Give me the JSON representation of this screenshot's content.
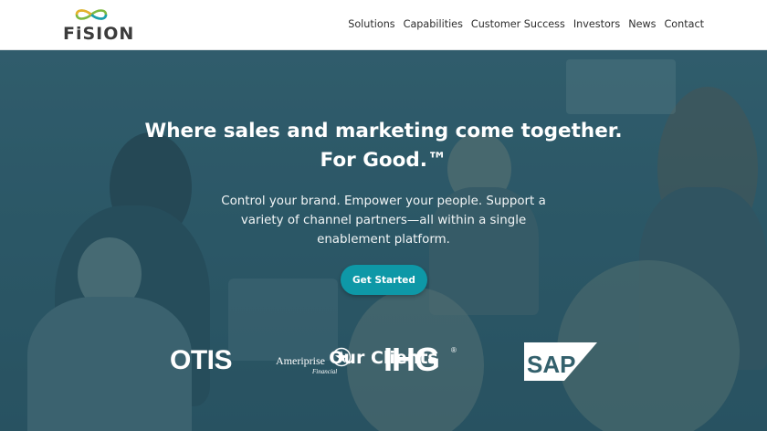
{
  "header": {
    "logo_text": "FiSION",
    "nav": [
      {
        "label": "Solutions"
      },
      {
        "label": "Capabilities"
      },
      {
        "label": "Customer Success"
      },
      {
        "label": "Investors"
      },
      {
        "label": "News"
      },
      {
        "label": "Contact"
      }
    ]
  },
  "hero": {
    "headline_line1": "Where sales and marketing come together.",
    "headline_line2": "For Good.™",
    "subtext": "Control your brand. Empower your people. Support a variety of channel partners—all within a single enablement platform.",
    "cta_label": "Get Started",
    "clients_heading": "Our Clients"
  },
  "clients": {
    "otis": "OTIS",
    "ameriprise": "Ameriprise",
    "ameriprise_sub": "Financial",
    "ihg": "IHG",
    "ihg_mark": "®",
    "sap": "SAP"
  },
  "colors": {
    "cta": "#0e98a7",
    "logo_green": "#7db940",
    "logo_teal": "#1a9fb0",
    "logo_yellow": "#e8b12a",
    "hero_overlay": "#3b6573"
  }
}
